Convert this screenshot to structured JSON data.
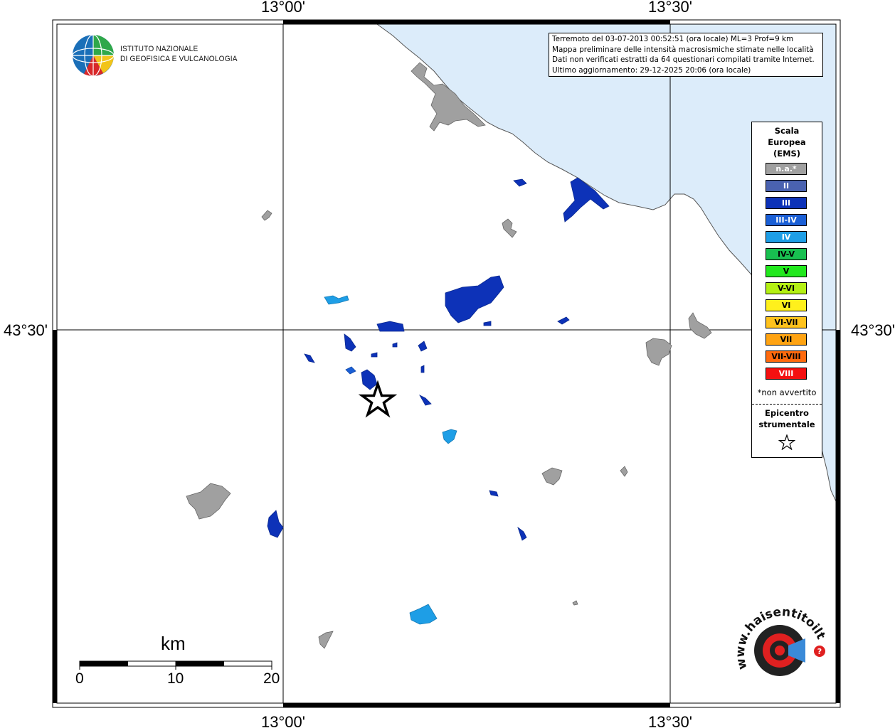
{
  "map": {
    "top_ticks": [
      "13°00'",
      "13°30'"
    ],
    "bottom_ticks": [
      "13°00'",
      "13°30'"
    ],
    "left_tick": "43°30'",
    "right_tick": "43°30'"
  },
  "info": {
    "line1": "Terremoto del 03-07-2013 00:52:51 (ora locale) ML=3 Prof=9 km",
    "line2": "Mappa preliminare delle intensità macrosismiche stimate nelle località",
    "line3": "Dati non verificati estratti da 64 questionari compilati tramite Internet.",
    "line4": "Ultimo aggiornamento: 29-12-2025 20:06 (ora locale)"
  },
  "logo": {
    "line1": "ISTITUTO NAZIONALE",
    "line2": "DI GEOFISICA E VULCANOLOGIA"
  },
  "legend": {
    "title1": "Scala",
    "title2": "Europea",
    "title3": "(EMS)",
    "items": [
      {
        "label": "n.a.*",
        "color": "#a0a0a0",
        "text_color": "#ffffff"
      },
      {
        "label": "II",
        "color": "#4a62b0",
        "text_color": "#ffffff"
      },
      {
        "label": "III",
        "color": "#0d32b8",
        "text_color": "#ffffff"
      },
      {
        "label": "III-IV",
        "color": "#1a5fd6",
        "text_color": "#ffffff"
      },
      {
        "label": "IV",
        "color": "#1e9ee6",
        "text_color": "#ffffff"
      },
      {
        "label": "IV-V",
        "color": "#18c050",
        "text_color": "#000000"
      },
      {
        "label": "V",
        "color": "#22e81e",
        "text_color": "#000000"
      },
      {
        "label": "V-VI",
        "color": "#b4f014",
        "text_color": "#000000"
      },
      {
        "label": "VI",
        "color": "#fff01c",
        "text_color": "#000000"
      },
      {
        "label": "VI-VII",
        "color": "#ffc21c",
        "text_color": "#000000"
      },
      {
        "label": "VII",
        "color": "#ffa312",
        "text_color": "#000000"
      },
      {
        "label": "VII-VIII",
        "color": "#ff6a0e",
        "text_color": "#000000"
      },
      {
        "label": "VIII",
        "color": "#f41010",
        "text_color": "#ffffff"
      }
    ],
    "note": "*non avvertito",
    "epicentre1": "Epicentro",
    "epicentre2": "strumentale"
  },
  "scalebar": {
    "unit": "km",
    "labels": [
      "0",
      "10",
      "20"
    ]
  },
  "watermark": {
    "text": "www.haisentitoilterremoto.it"
  },
  "colors": {
    "sea": "#dcecfa",
    "na": "#a0a0a0",
    "ems_III": "#0d32b8",
    "ems_III_IV": "#1a5fd6",
    "ems_IV": "#1e9ee6"
  }
}
